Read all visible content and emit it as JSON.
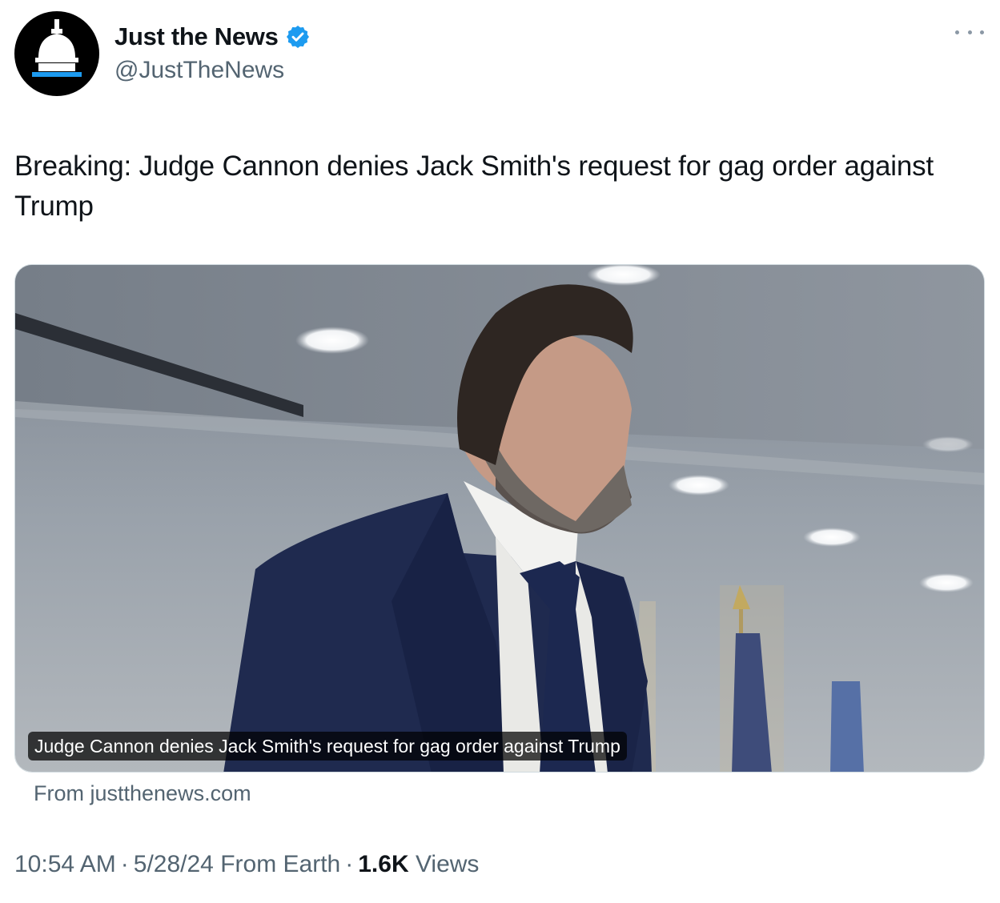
{
  "account": {
    "display_name": "Just the News",
    "handle": "@JustTheNews",
    "verified": true,
    "verified_color": "#1d9bf0",
    "avatar_icon": "capitol-dome-icon",
    "avatar_accent": "#1d9bf0"
  },
  "menu": {
    "more_icon": "more-horizontal-icon"
  },
  "tweet": {
    "text": "Breaking: Judge Cannon denies Jack Smith's request for gag order against Trump"
  },
  "card": {
    "caption": "Judge Cannon denies Jack Smith's request for gag order against Trump",
    "source": "From justthenews.com"
  },
  "meta": {
    "time": "10:54 AM",
    "date": "5/28/24",
    "location": "From Earth",
    "views_count": "1.6K",
    "views_label": "Views",
    "separator": "·"
  }
}
